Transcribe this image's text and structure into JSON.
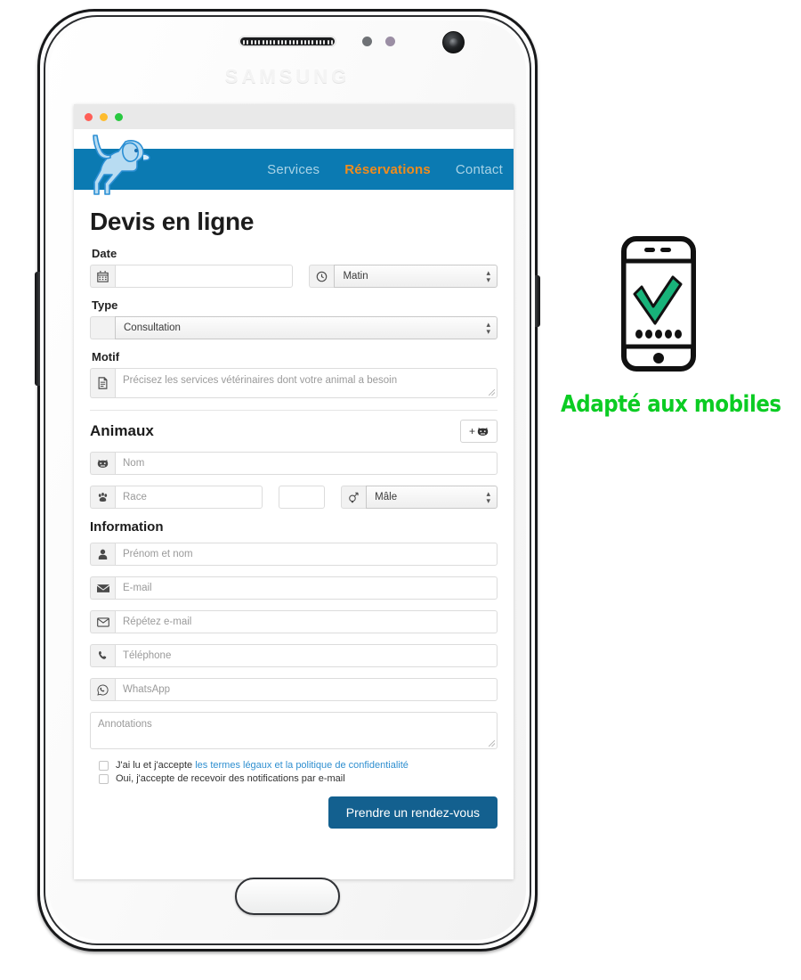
{
  "device": {
    "brand": "SAMSUNG",
    "speaker_icon": "speaker-grille-icon",
    "camera_icon": "front-camera-icon",
    "home_button": "home-button"
  },
  "browser": {
    "window_dots": [
      "close-dot",
      "minimize-dot",
      "maximize-dot"
    ]
  },
  "site": {
    "logo_alt": "dog-logo",
    "nav": [
      {
        "label": "Services",
        "active": false
      },
      {
        "label": "Réservations",
        "active": true
      },
      {
        "label": "Contact",
        "active": false
      }
    ],
    "nav_color": "#0b7ab2",
    "nav_link_color": "#a8d3e6",
    "nav_active_color": "#f28c1c"
  },
  "form": {
    "page_title": "Devis en ligne",
    "date": {
      "label": "Date",
      "input_value": "",
      "input_placeholder": "",
      "icon": "calendar-icon",
      "time_icon": "clock-icon",
      "time_value": "Matin"
    },
    "type": {
      "label": "Type",
      "value": "Consultation"
    },
    "motif": {
      "label": "Motif",
      "icon": "document-icon",
      "placeholder": "Précisez les services vétérinaires dont votre animal a besoin"
    },
    "animaux": {
      "title": "Animaux",
      "add_label": "+",
      "add_icon": "pet-add-icon",
      "name_icon": "pet-face-icon",
      "name_placeholder": "Nom",
      "race_icon": "paw-icon",
      "race_placeholder": "Race",
      "extra_value": "",
      "gender_icon": "gender-icon",
      "gender_value": "Mâle"
    },
    "information": {
      "title": "Information",
      "fields": [
        {
          "icon": "user-icon",
          "placeholder": "Prénom et nom"
        },
        {
          "icon": "mail-solid-icon",
          "placeholder": "E-mail"
        },
        {
          "icon": "mail-outline-icon",
          "placeholder": "Répétez e-mail"
        },
        {
          "icon": "phone-icon",
          "placeholder": "Téléphone"
        },
        {
          "icon": "whatsapp-icon",
          "placeholder": "WhatsApp"
        }
      ],
      "annotations_placeholder": "Annotations"
    },
    "consents": [
      {
        "text_before": "J'ai lu et j'accepte ",
        "link_text": "les termes légaux et la politique de confidentialité",
        "checked": false
      },
      {
        "text_before": "Oui, j'accepte de recevoir des notifications par e-mail",
        "link_text": "",
        "checked": false
      }
    ],
    "submit_label": "Prendre un rendez-vous",
    "submit_color": "#13608f"
  },
  "promo": {
    "icon": "mobile-check-icon",
    "text": "Adapté aux mobiles",
    "text_color": "#0bcc23",
    "check_color": "#18b37a"
  }
}
